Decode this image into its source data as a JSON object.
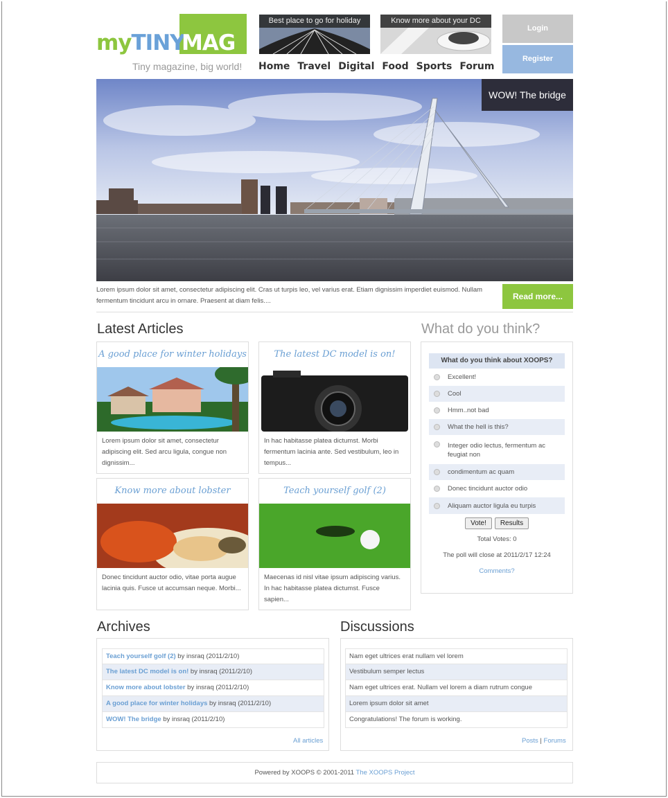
{
  "brand": {
    "my": "my",
    "tiny": "TINY",
    "mag": "MAG",
    "tagline": "Tiny magazine, big world!"
  },
  "promos": [
    {
      "caption": "Best place to go for holiday"
    },
    {
      "caption": "Know more about your DC"
    }
  ],
  "nav": [
    "Home",
    "Travel",
    "Digital",
    "Food",
    "Sports",
    "Forum"
  ],
  "auth": {
    "login": "Login",
    "register": "Register"
  },
  "hero": {
    "badge": "WOW! The bridge",
    "text": "Lorem ipsum dolor sit amet, consectetur adipiscing elit. Cras ut turpis leo, vel varius erat. Etiam dignissim imperdiet euismod. Nullam fermentum tincidunt arcu in ornare. Praesent at diam felis....",
    "read_more": "Read more..."
  },
  "latest": {
    "heading": "Latest Articles",
    "articles": [
      {
        "title": "A good place for winter holidays",
        "text": "Lorem ipsum dolor sit amet, consectetur adipiscing elit. Sed arcu ligula, congue non dignissim..."
      },
      {
        "title": "The latest DC model is on!",
        "text": "In hac habitasse platea dictumst. Morbi fermentum lacinia ante. Sed vestibulum, leo in tempus..."
      },
      {
        "title": "Know more about lobster",
        "text": "Donec tincidunt auctor odio, vitae porta augue lacinia quis. Fusce ut accumsan neque. Morbi..."
      },
      {
        "title": "Teach yourself golf (2)",
        "text": "Maecenas id nisl vitae ipsum adipiscing varius. In hac habitasse platea dictumst. Fusce sapien..."
      }
    ]
  },
  "poll": {
    "heading": "What do you think?",
    "question": "What do you think about XOOPS?",
    "options": [
      "Excellent!",
      "Cool",
      "Hmm..not bad",
      "What the hell is this?",
      "Integer odio lectus, fermentum ac feugiat non",
      "condimentum ac quam",
      "Donec tincidunt auctor odio",
      "Aliquam auctor ligula eu turpis"
    ],
    "vote": "Vote!",
    "results": "Results",
    "total": "Total Votes: 0",
    "close": "The poll will close at 2011/2/17 12:24",
    "comments": "Comments?"
  },
  "archives": {
    "heading": "Archives",
    "items": [
      {
        "title": "Teach yourself golf (2)",
        "meta": " by insraq (2011/2/10)"
      },
      {
        "title": "The latest DC model is on!",
        "meta": " by insraq (2011/2/10)"
      },
      {
        "title": "Know more about lobster",
        "meta": " by insraq (2011/2/10)"
      },
      {
        "title": "A good place for winter holidays",
        "meta": " by insraq (2011/2/10)"
      },
      {
        "title": "WOW! The bridge",
        "meta": " by insraq (2011/2/10)"
      }
    ],
    "all": "All articles"
  },
  "discussions": {
    "heading": "Discussions",
    "items": [
      "Nam eget ultrices erat nullam vel lorem",
      "Vestibulum semper lectus",
      "Nam eget ultrices erat. Nullam vel lorem a diam rutrum congue",
      "Lorem ipsum dolor sit amet",
      "Congratulations! The forum is working."
    ],
    "posts": "Posts",
    "sep": "|",
    "forums": "Forums"
  },
  "footer": {
    "text": "Powered by XOOPS © 2001-2011 ",
    "link": "The XOOPS Project"
  }
}
